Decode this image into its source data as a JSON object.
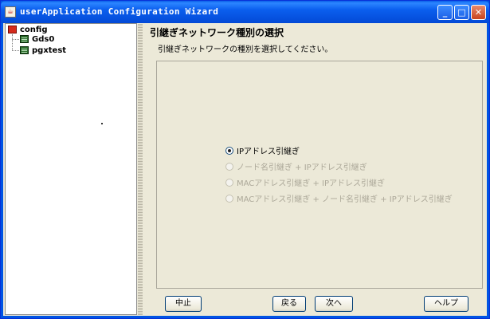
{
  "window": {
    "title": "userApplication Configuration Wizard",
    "icon": "java-app-icon",
    "controls": [
      "minimize-icon",
      "maximize-icon",
      "close-icon"
    ]
  },
  "tree": {
    "root": {
      "label": "config",
      "icon": "config-icon",
      "color": "#d42a1c"
    },
    "children": [
      {
        "label": "Gds0",
        "icon": "resource-icon"
      },
      {
        "label": "pgxtest",
        "icon": "resource-icon"
      }
    ]
  },
  "main": {
    "section_title": "引継ぎネットワーク種別の選択",
    "instruction": "引継ぎネットワークの種別を選択してください。",
    "options": [
      {
        "label": "IPアドレス引継ぎ",
        "selected": true,
        "enabled": true
      },
      {
        "label": "ノード名引継ぎ + IPアドレス引継ぎ",
        "selected": false,
        "enabled": false
      },
      {
        "label": "MACアドレス引継ぎ + IPアドレス引継ぎ",
        "selected": false,
        "enabled": false
      },
      {
        "label": "MACアドレス引継ぎ + ノード名引継ぎ + IPアドレス引継ぎ",
        "selected": false,
        "enabled": false
      }
    ]
  },
  "buttons": {
    "cancel": "中止",
    "back": "戻る",
    "next": "次へ",
    "help": "ヘルプ"
  },
  "colors": {
    "titlebar": "#0054e3",
    "background": "#ece9d8",
    "disabled_text": "#aca899"
  }
}
